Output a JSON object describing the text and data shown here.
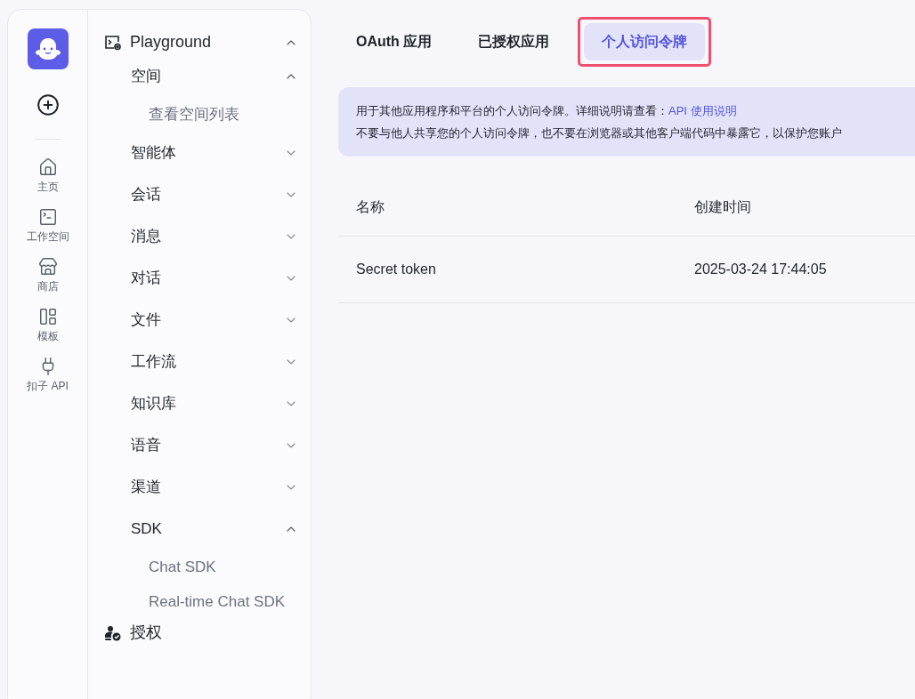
{
  "rail": {
    "items": [
      {
        "label": "主页",
        "kind": "home"
      },
      {
        "label": "工作空间",
        "kind": "folder"
      },
      {
        "label": "商店",
        "kind": "store"
      },
      {
        "label": "模板",
        "kind": "layout"
      },
      {
        "label": "扣子 API",
        "kind": "plug"
      }
    ]
  },
  "menu": [
    {
      "label": "Playground",
      "kind": "playground",
      "expanded": true,
      "children": [
        {
          "label": "空间",
          "expanded": true,
          "children": [
            {
              "label": "查看空间列表"
            }
          ]
        },
        {
          "label": "智能体",
          "expanded": false
        },
        {
          "label": "会话",
          "expanded": false
        },
        {
          "label": "消息",
          "expanded": false
        },
        {
          "label": "对话",
          "expanded": false
        },
        {
          "label": "文件",
          "expanded": false
        },
        {
          "label": "工作流",
          "expanded": false
        },
        {
          "label": "知识库",
          "expanded": false
        },
        {
          "label": "语音",
          "expanded": false
        },
        {
          "label": "渠道",
          "expanded": false
        },
        {
          "label": "SDK",
          "expanded": true,
          "children": [
            {
              "label": "Chat SDK"
            },
            {
              "label": "Real-time Chat SDK"
            }
          ]
        }
      ]
    },
    {
      "label": "授权",
      "kind": "auth"
    }
  ],
  "tabs": [
    {
      "label": "OAuth 应用",
      "selected": false,
      "highlighted": false
    },
    {
      "label": "已授权应用",
      "selected": false,
      "highlighted": false
    },
    {
      "label": "个人访问令牌",
      "selected": true,
      "highlighted": true
    }
  ],
  "notice": {
    "line_1": "用于其他应用程序和平台的个人访问令牌。详细说明请查看：",
    "link": "API 使用说明",
    "line_2": "不要与他人共享您的个人访问令牌，也不要在浏览器或其他客户端代码中暴露它，以保护您账户"
  },
  "table": {
    "columns": [
      "名称",
      "创建时间"
    ],
    "rows": [
      [
        "Secret token",
        "2025-03-24 17:44:05"
      ]
    ]
  }
}
